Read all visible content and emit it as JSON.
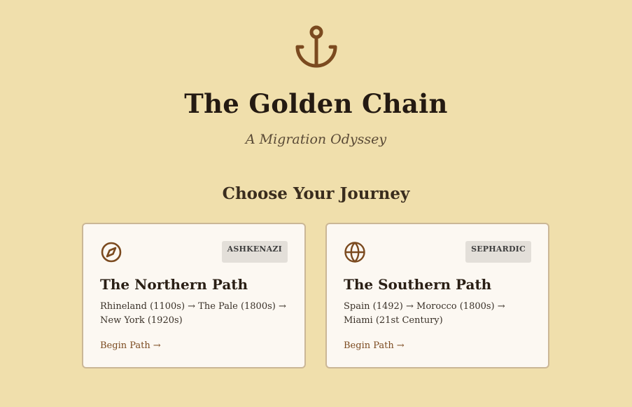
{
  "header": {
    "icon": "anchor-icon",
    "title": "The Golden Chain",
    "subtitle": "A Migration Odyssey"
  },
  "section": {
    "title": "Choose Your Journey"
  },
  "cards": [
    {
      "icon": "compass-icon",
      "badge": "ASHKENAZI",
      "title": "The Northern Path",
      "description": "Rhineland (1100s) → The Pale (1800s) → New York (1920s)",
      "link_label": "Begin Path",
      "link_arrow": "→"
    },
    {
      "icon": "globe-icon",
      "badge": "SEPHARDIC",
      "title": "The Southern Path",
      "description": "Spain (1492) → Morocco (1800s) → Miami (21st Century)",
      "link_label": "Begin Path",
      "link_arrow": "→"
    }
  ],
  "colors": {
    "background": "#f0dfac",
    "accent": "#7b4a1f",
    "card_background": "#fcf8f2",
    "card_border": "#cbb796",
    "badge_background": "#e3dfd9"
  }
}
